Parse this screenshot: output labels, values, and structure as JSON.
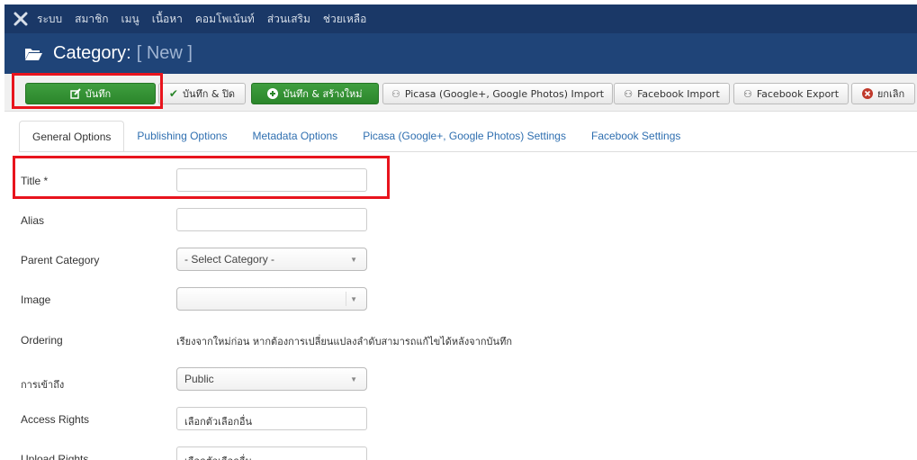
{
  "menubar": {
    "items": [
      "ระบบ",
      "สมาชิก",
      "เมนู",
      "เนื้อหา",
      "คอมโพเน้นท์",
      "ส่วนเสริม",
      "ช่วยเหลือ"
    ],
    "logo_icon": "joomla-logo-icon"
  },
  "header": {
    "title": "Category:",
    "subtitle": "[ New ]",
    "icon": "folder-open-icon"
  },
  "toolbar": {
    "save_label": "บันทึก",
    "save_close_label": "บันทึก & ปิด",
    "save_new_label": "บันทึก & สร้างใหม่",
    "picasa_import_label": "Picasa (Google+, Google Photos) Import",
    "facebook_import_label": "Facebook Import",
    "facebook_export_label": "Facebook Export",
    "cancel_label": "ยกเลิก"
  },
  "tabs": [
    {
      "label": "General Options",
      "active": true
    },
    {
      "label": "Publishing Options",
      "active": false
    },
    {
      "label": "Metadata Options",
      "active": false
    },
    {
      "label": "Picasa (Google+, Google Photos) Settings",
      "active": false
    },
    {
      "label": "Facebook Settings",
      "active": false
    }
  ],
  "form": {
    "title_label": "Title *",
    "title_value": "",
    "alias_label": "Alias",
    "alias_value": "",
    "parent_label": "Parent Category",
    "parent_value": "- Select Category -",
    "image_label": "Image",
    "image_value": "",
    "ordering_label": "Ordering",
    "ordering_text": "เรียงจากใหม่ก่อน หากต้องการเปลี่ยนแปลงลำดับสามารถแก้ไขได้หลังจากบันทึก",
    "access_label": "การเข้าถึง",
    "access_value": "Public",
    "access_rights_label": "Access Rights",
    "access_rights_value": "เลือกตัวเลือกอื่น",
    "upload_rights_label": "Upload Rights",
    "upload_rights_value": "เลือกตัวเลือกอื่น"
  },
  "colors": {
    "menubar_bg": "#1a3867",
    "titlebar_bg": "#1f4478",
    "green_button": "#2e8b2e",
    "highlight": "#e8141d",
    "tab_link": "#2f6fb0"
  }
}
